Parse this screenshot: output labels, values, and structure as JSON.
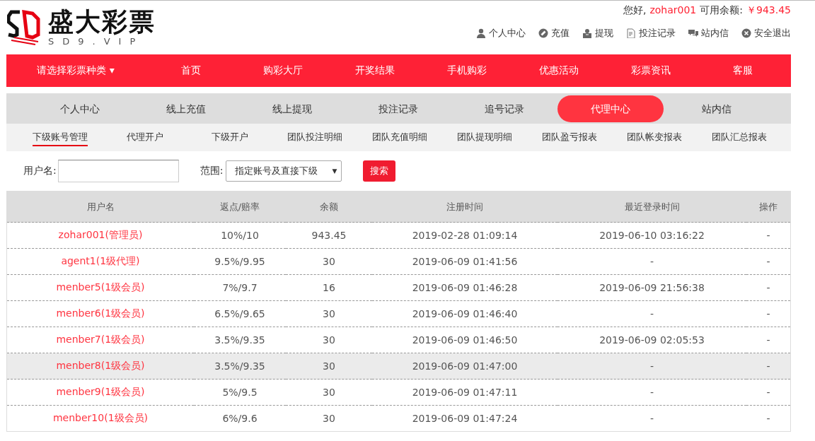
{
  "header": {
    "logo_text": "盛大彩票",
    "logo_subtext": "SD9.VIP",
    "greeting": "您好,",
    "username": "zohar001",
    "balance_label": "可用余额:",
    "balance": "￥943.45",
    "links": [
      {
        "label": "个人中心"
      },
      {
        "label": "充值"
      },
      {
        "label": "提现"
      },
      {
        "label": "投注记录"
      },
      {
        "label": "站内信"
      },
      {
        "label": "安全退出"
      }
    ]
  },
  "main_nav": [
    {
      "label": "请选择彩票种类",
      "dropdown": true
    },
    {
      "label": "首页",
      "dropdown": false
    },
    {
      "label": "购彩大厅",
      "dropdown": false
    },
    {
      "label": "开奖结果",
      "dropdown": false
    },
    {
      "label": "手机购彩",
      "dropdown": false
    },
    {
      "label": "优惠活动",
      "dropdown": false
    },
    {
      "label": "彩票资讯",
      "dropdown": false
    },
    {
      "label": "客服",
      "dropdown": false
    }
  ],
  "dropdown_caret": "▾",
  "account_tabs": [
    {
      "label": "个人中心",
      "selected": false
    },
    {
      "label": "线上充值",
      "selected": false
    },
    {
      "label": "线上提现",
      "selected": false
    },
    {
      "label": "投注记录",
      "selected": false
    },
    {
      "label": "追号记录",
      "selected": false
    },
    {
      "label": "代理中心",
      "selected": true
    },
    {
      "label": "站内信",
      "selected": false
    }
  ],
  "agent_tabs": [
    {
      "label": "下级账号管理",
      "selected": true
    },
    {
      "label": "代理开户",
      "selected": false
    },
    {
      "label": "下级开户",
      "selected": false
    },
    {
      "label": "团队投注明细",
      "selected": false
    },
    {
      "label": "团队充值明细",
      "selected": false
    },
    {
      "label": "团队提现明细",
      "selected": false
    },
    {
      "label": "团队盈亏报表",
      "selected": false
    },
    {
      "label": "团队帐变报表",
      "selected": false
    },
    {
      "label": "团队汇总报表",
      "selected": false
    }
  ],
  "search": {
    "username_label": "用户名:",
    "scope_label": "范围:",
    "scope_value": "指定账号及直接下级",
    "select_arrow": "▼",
    "button": "搜索"
  },
  "table": {
    "columns": [
      "用户名",
      "返点/赔率",
      "余额",
      "注册时间",
      "最近登录时间",
      "操作"
    ],
    "rows": [
      {
        "user": "zohar001(管理员)",
        "rebate": "10%/10",
        "balance": "943.45",
        "registered": "2019-02-28 01:09:14",
        "last_login": "2019-06-10 03:16:22",
        "action": "-",
        "selected": false
      },
      {
        "user": "agent1(1级代理)",
        "rebate": "9.5%/9.95",
        "balance": "30",
        "registered": "2019-06-09 01:41:56",
        "last_login": "-",
        "action": "-",
        "selected": false
      },
      {
        "user": "menber5(1级会员)",
        "rebate": "7%/9.7",
        "balance": "16",
        "registered": "2019-06-09 01:46:28",
        "last_login": "2019-06-09 21:56:38",
        "action": "-",
        "selected": false
      },
      {
        "user": "menber6(1级会员)",
        "rebate": "6.5%/9.65",
        "balance": "30",
        "registered": "2019-06-09 01:46:40",
        "last_login": "-",
        "action": "-",
        "selected": false
      },
      {
        "user": "menber7(1级会员)",
        "rebate": "3.5%/9.35",
        "balance": "30",
        "registered": "2019-06-09 01:46:50",
        "last_login": "2019-06-09 02:05:53",
        "action": "-",
        "selected": false
      },
      {
        "user": "menber8(1级会员)",
        "rebate": "3.5%/9.35",
        "balance": "30",
        "registered": "2019-06-09 01:47:00",
        "last_login": "-",
        "action": "-",
        "selected": true
      },
      {
        "user": "menber9(1级会员)",
        "rebate": "5%/9.5",
        "balance": "30",
        "registered": "2019-06-09 01:47:11",
        "last_login": "-",
        "action": "-",
        "selected": false
      },
      {
        "user": "menber10(1级会员)",
        "rebate": "6%/9.6",
        "balance": "30",
        "registered": "2019-06-09 01:47:24",
        "last_login": "-",
        "action": "-",
        "selected": false
      }
    ]
  }
}
